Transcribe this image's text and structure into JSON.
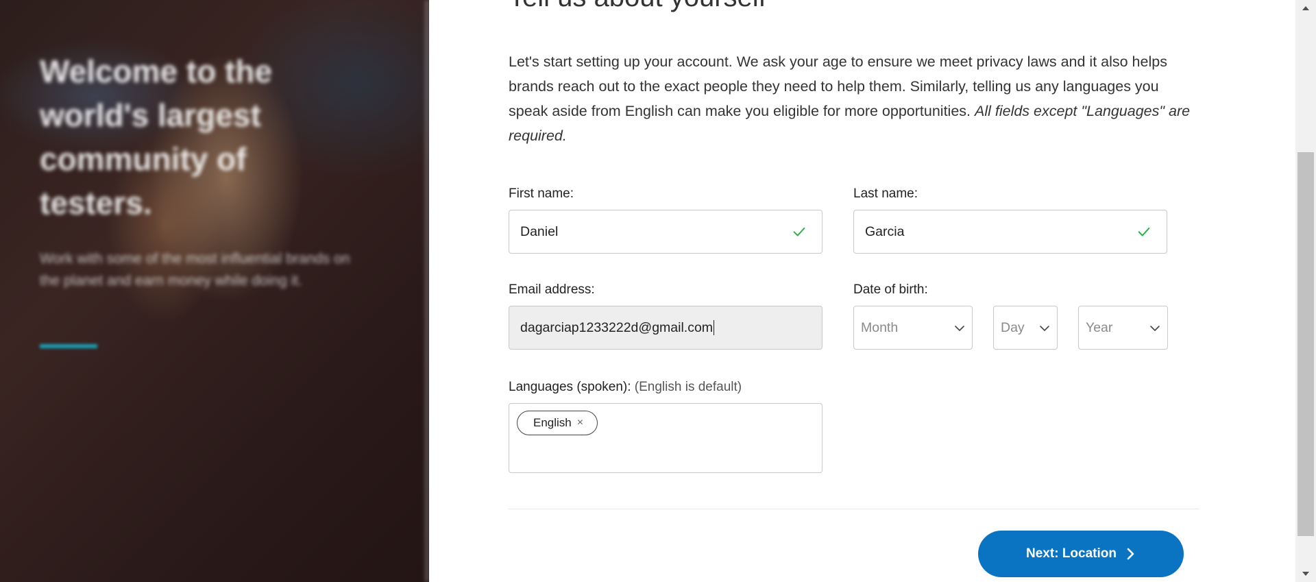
{
  "hero": {
    "title": "Welcome to the world's largest community of testers.",
    "subtitle": "Work with some of the most influential brands on the planet and earn money while doing it."
  },
  "page": {
    "title": "Tell us about yourself",
    "intro": "Let's start setting up your account. We ask your age to ensure we meet privacy laws and it also helps brands reach out to the exact people they need to help them. Similarly, telling us any languages you speak aside from English can make you eligible for more opportunities. ",
    "intro_emphasis": "All fields except \"Languages\" are required."
  },
  "form": {
    "first_name": {
      "label": "First name:",
      "value": "Daniel",
      "valid": true
    },
    "last_name": {
      "label": "Last name:",
      "value": "Garcia",
      "valid": true
    },
    "email": {
      "label": "Email address:",
      "value": "dagarciap1233222d@gmail.com"
    },
    "dob": {
      "label": "Date of birth:",
      "month_placeholder": "Month",
      "day_placeholder": "Day",
      "year_placeholder": "Year"
    },
    "languages": {
      "label": "Languages (spoken):",
      "hint": "(English is default)",
      "tags": [
        "English"
      ],
      "remove_glyph": "×"
    }
  },
  "actions": {
    "next_label": "Next: Location"
  },
  "colors": {
    "primary_button": "#0a74c2",
    "check": "#2bb14a",
    "hero_accent": "#1a9fb5"
  },
  "icons": {
    "field_valid": "checkmark-icon",
    "select_open": "chevron-down-icon",
    "next": "chevron-right-icon",
    "scroll_up": "triangle-up-icon",
    "scroll_down": "triangle-down-icon"
  }
}
